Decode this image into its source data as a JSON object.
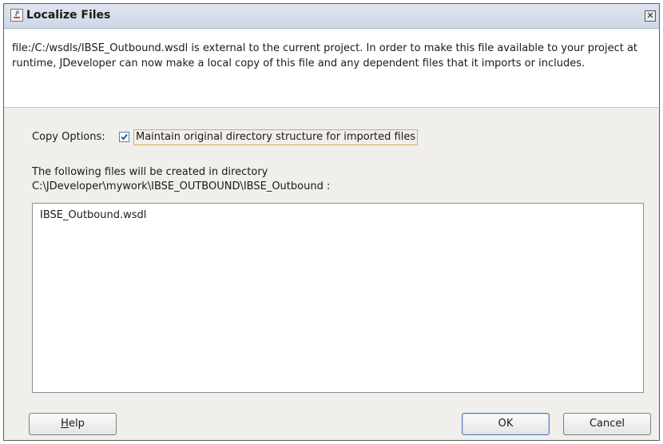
{
  "window": {
    "title": "Localize Files",
    "close_glyph": "✕"
  },
  "description": "file:/C:/wsdls/IBSE_Outbound.wsdl is external to the current project. In order to make this file available to your project at runtime, JDeveloper can now make a local copy of this file and any dependent files that it imports or includes.",
  "copy_options": {
    "label": "Copy Options:",
    "checkbox_label": "Maintain original directory structure for imported files",
    "checked": true
  },
  "files": {
    "intro_line1": "The following files will be created in directory",
    "intro_line2": "C:\\JDeveloper\\mywork\\IBSE_OUTBOUND\\IBSE_Outbound :",
    "items": [
      "IBSE_Outbound.wsdl"
    ]
  },
  "buttons": {
    "help_mnemonic": "H",
    "help_rest": "elp",
    "ok": "OK",
    "cancel": "Cancel"
  },
  "colors": {
    "focus_outline": "#e8a545",
    "check_mark": "#1f4f9e"
  }
}
